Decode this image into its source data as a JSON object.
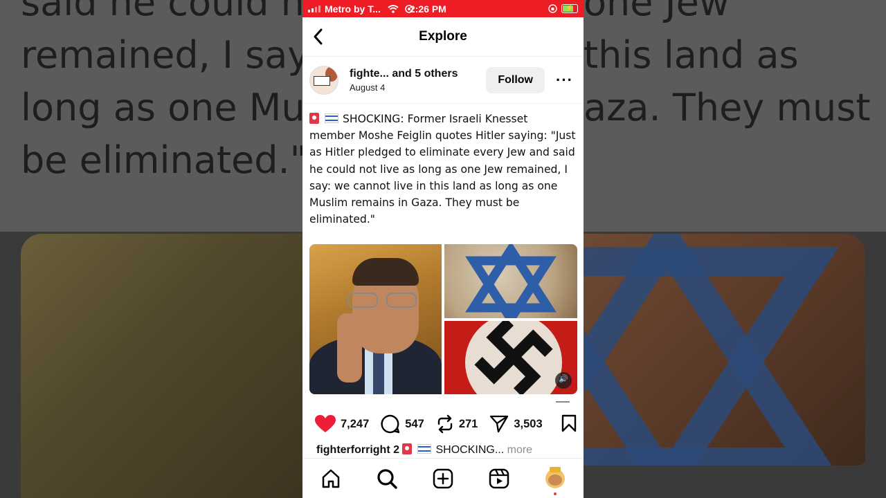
{
  "background": {
    "text_left": [
      "said he could no",
      "remained, I say: w",
      "long as one Musl",
      "be eliminated.\""
    ],
    "text_right": [
      "one Jew",
      "this land as",
      "aza. They must",
      ""
    ]
  },
  "status_bar": {
    "carrier": "Metro by T...",
    "time": "2:26 PM",
    "bg_color": "#ee1c25"
  },
  "nav": {
    "title": "Explore",
    "back_icon": "chevron-left-icon"
  },
  "post": {
    "author": "fighte... and 5 others",
    "date": "August 4",
    "follow_label": "Follow",
    "more_label": "•••",
    "caption_line1": "SHOCKING: Former Israeli Knesset",
    "caption_rest": "member Moshe Feiglin quotes Hitler saying: \"Just as Hitler pledged to eliminate every Jew and said he could not live as long as one Jew remained, I say: we cannot live in this land as long as one Muslim remains in Gaza. They must be eliminated.\""
  },
  "actions": {
    "likes": "7,247",
    "comments": "547",
    "reposts": "271",
    "shares": "3,503",
    "like_color": "#ed1d3a"
  },
  "comment": {
    "username": "fighterforright",
    "count": "2",
    "preview": "SHOCKING...",
    "more": "more"
  },
  "tabbar": {
    "items": [
      "home-icon",
      "search-icon",
      "create-icon",
      "reels-icon",
      "profile-avatar"
    ]
  }
}
